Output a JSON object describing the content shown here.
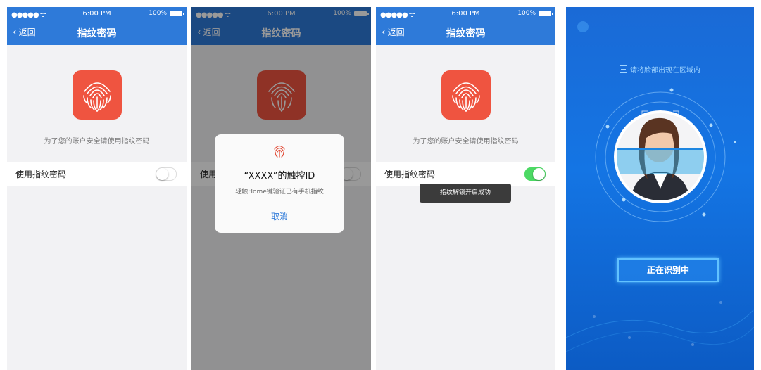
{
  "status_bar": {
    "signal": "●●●●● ᯤ",
    "time": "6:00 PM",
    "battery": "100%"
  },
  "nav": {
    "back_label": "返回",
    "title": "指纹密码"
  },
  "screen1": {
    "hint": "为了您的账户安全请使用指纹密码",
    "row_label": "使用指纹密码",
    "toggle_on": false
  },
  "screen2": {
    "row_label_partial": "使用",
    "dialog": {
      "title": "“XXXX”的触控ID",
      "message": "轻触Home键验证已有手机指纹",
      "cancel": "取消"
    }
  },
  "screen3": {
    "hint": "为了您的账户安全请使用指纹密码",
    "row_label": "使用指纹密码",
    "toggle_on": true,
    "toast": "指纹解锁开启成功"
  },
  "screen4": {
    "hint": "请将脸部出现在区域内",
    "status_button": "正在识别中"
  },
  "colors": {
    "nav_blue": "#2e7ad9",
    "fingerprint_red": "#ef5440",
    "toggle_green": "#4cd964",
    "scan_blue": "#1475e4"
  },
  "icons": [
    "back-chevron-icon",
    "fingerprint-icon",
    "face-scan-icon",
    "battery-icon",
    "wifi-signal-icon"
  ]
}
